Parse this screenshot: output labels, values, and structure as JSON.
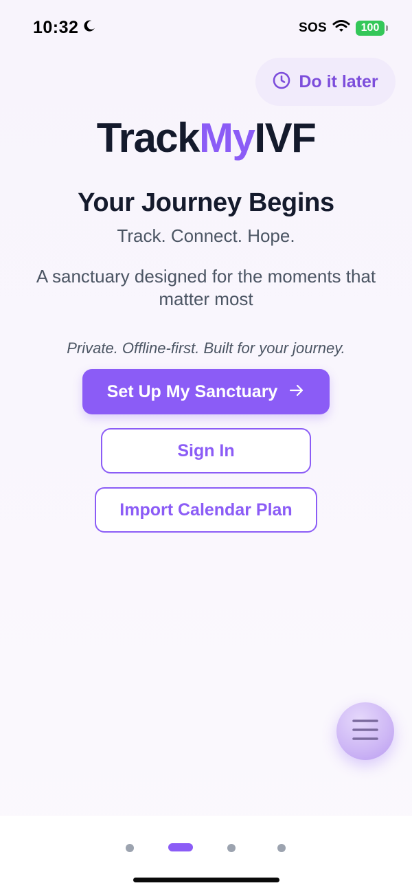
{
  "status_bar": {
    "time": "10:32",
    "moon_icon": "moon-icon",
    "sos": "SOS",
    "wifi_icon": "wifi-icon",
    "battery": "100",
    "battery_color": "#34c759"
  },
  "header": {
    "later_label": "Do it later",
    "later_icon": "clock-icon"
  },
  "logo": {
    "part1": "Track",
    "part2": "My",
    "part3": "IVF"
  },
  "hero": {
    "title": "Your Journey Begins",
    "tagline": "Track. Connect. Hope.",
    "description": "A sanctuary designed for the moments that matter most",
    "privacy": "Private. Offline-first. Built for your journey."
  },
  "actions": {
    "primary_label": "Set Up My Sanctuary",
    "primary_icon": "arrow-right-icon",
    "signin_label": "Sign In",
    "import_label": "Import Calendar Plan"
  },
  "fab": {
    "icon": "menu-icon"
  },
  "pagination": {
    "current_page": 2,
    "total_pages": 4
  },
  "colors": {
    "accent": "#8b5cf6",
    "heading": "#141a2c",
    "body_text": "#4b5563"
  }
}
